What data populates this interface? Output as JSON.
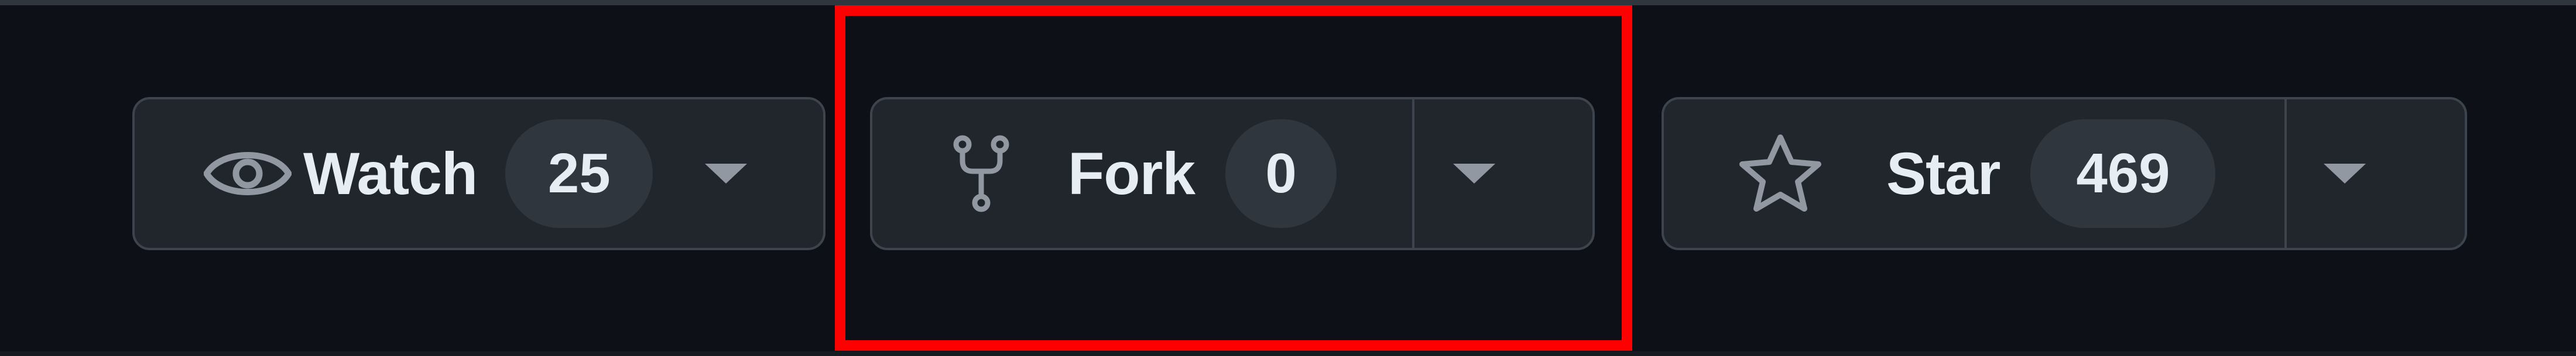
{
  "actions": {
    "watch": {
      "label": "Watch",
      "count": "25",
      "icon": "eye-icon"
    },
    "fork": {
      "label": "Fork",
      "count": "0",
      "icon": "repo-forked-icon"
    },
    "star": {
      "label": "Star",
      "count": "469",
      "icon": "star-icon"
    }
  },
  "highlight": {
    "target": "fork",
    "color": "#fe0000"
  },
  "colors": {
    "background": "#0d1117",
    "button": "#21262d",
    "border": "#3d444d",
    "counter": "#30363d",
    "text": "#e6edf3",
    "icon": "#9198a1"
  }
}
